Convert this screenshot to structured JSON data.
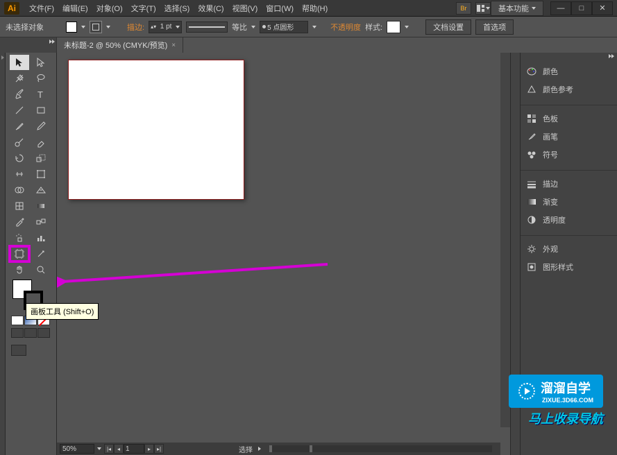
{
  "app": {
    "logo": "Ai"
  },
  "menu": {
    "file": "文件(F)",
    "edit": "编辑(E)",
    "object": "对象(O)",
    "type": "文字(T)",
    "select": "选择(S)",
    "effect": "效果(C)",
    "view": "视图(V)",
    "window": "窗口(W)",
    "help": "帮助(H)"
  },
  "workspace": {
    "label": "基本功能"
  },
  "window_controls": {
    "min": "—",
    "max": "□",
    "close": "✕"
  },
  "controlbar": {
    "no_selection": "未选择对象",
    "stroke_label": "描边:",
    "stroke_pt": "1 pt",
    "uniform": "等比",
    "brush_value": "5 点圆形",
    "opacity": "不透明度",
    "style": "样式:",
    "doc_setup": "文档设置",
    "preferences": "首选项"
  },
  "document": {
    "tab_name": "未标题-2 @ 50% (CMYK/预览)"
  },
  "tooltip": {
    "text": "画板工具 (Shift+O)"
  },
  "statusbar": {
    "zoom": "50%",
    "page": "1",
    "mode": "选择"
  },
  "right_panel": {
    "color": "颜色",
    "color_guide": "颜色参考",
    "swatches": "色板",
    "brushes": "画笔",
    "symbols": "符号",
    "stroke": "描边",
    "gradient": "渐变",
    "transparency": "透明度",
    "appearance": "外观",
    "graphic_styles": "图形样式"
  },
  "watermark": {
    "title": "溜溜自学",
    "url": "ZIXUE.3D66.COM",
    "subtitle": "马上收录导航"
  }
}
